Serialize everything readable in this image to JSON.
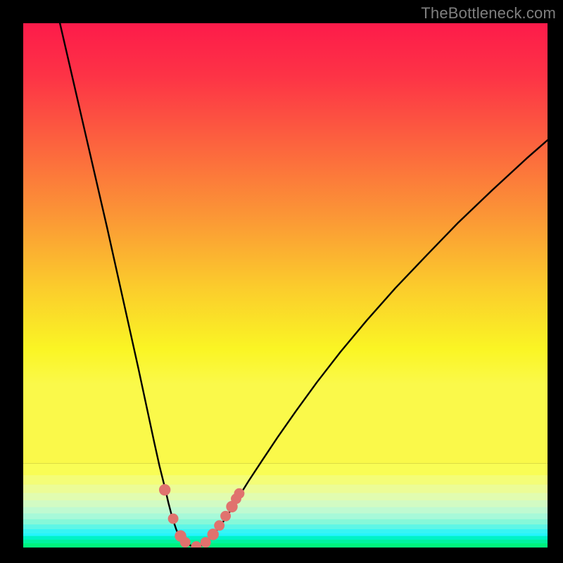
{
  "watermark": "TheBottleneck.com",
  "chart_data": {
    "type": "line",
    "title": "",
    "xlabel": "",
    "ylabel": "",
    "xlim": [
      0,
      100
    ],
    "ylim": [
      0,
      100
    ],
    "grid": false,
    "legend": false,
    "background_gradient": {
      "bands": [
        {
          "color": "#fd1b4a",
          "note": "top"
        },
        {
          "color": "#fc653e",
          "note": "upper-mid"
        },
        {
          "color": "#fbb631",
          "note": "mid"
        },
        {
          "color": "#faf524",
          "note": "lower-mid"
        },
        {
          "color": "#f9fd55",
          "note": "pale-yellow"
        },
        {
          "color": "#e1fcb0",
          "note": "yellow-green"
        },
        {
          "color": "#86f8d8",
          "note": "mint"
        },
        {
          "color": "#24f4fc",
          "note": "cyan"
        },
        {
          "color": "#00f37e",
          "note": "green-base"
        }
      ]
    },
    "series": [
      {
        "name": "bottleneck-curve-left",
        "stroke": "#000000",
        "x": [
          7,
          10,
          13,
          16,
          18,
          20,
          22,
          23.5,
          25,
          26,
          27,
          27.7,
          28.3,
          28.8,
          29.2,
          29.6,
          30.0,
          30.5,
          31.0,
          31.5,
          32.0,
          32.5,
          33.0
        ],
        "y": [
          100,
          87,
          74,
          61,
          52,
          43,
          34,
          27,
          20,
          15.5,
          11.5,
          8.5,
          6.2,
          4.6,
          3.4,
          2.5,
          1.9,
          1.3,
          0.9,
          0.6,
          0.35,
          0.2,
          0.1
        ]
      },
      {
        "name": "bottleneck-curve-right",
        "stroke": "#000000",
        "x": [
          33.0,
          33.5,
          34.0,
          34.6,
          35.3,
          36.1,
          37.1,
          38.2,
          39.5,
          41,
          43,
          45.5,
          48.5,
          52,
          56,
          60.5,
          65.5,
          71,
          77,
          83,
          89.5,
          96,
          100
        ],
        "y": [
          0.1,
          0.22,
          0.45,
          0.8,
          1.4,
          2.3,
          3.5,
          5.0,
          7.0,
          9.5,
          12.7,
          16.5,
          21.0,
          26.0,
          31.5,
          37.3,
          43.3,
          49.5,
          55.8,
          62.0,
          68.2,
          74.2,
          77.7
        ]
      }
    ],
    "markers": [
      {
        "x": 27.0,
        "y": 11.0,
        "r": 1.1,
        "color": "#e0726e",
        "name": "marker-left-upper"
      },
      {
        "x": 28.6,
        "y": 5.5,
        "r": 1.0,
        "color": "#e0726e",
        "name": "marker-left-mid"
      },
      {
        "x": 30.0,
        "y": 2.2,
        "r": 1.1,
        "color": "#e0726e",
        "name": "marker-left-low-a"
      },
      {
        "x": 30.9,
        "y": 1.0,
        "r": 1.0,
        "color": "#e0726e",
        "name": "marker-left-low-b"
      },
      {
        "x": 33.0,
        "y": 0.2,
        "r": 1.0,
        "color": "#e0726e",
        "name": "marker-valley"
      },
      {
        "x": 34.8,
        "y": 1.0,
        "r": 1.0,
        "color": "#e0726e",
        "name": "marker-right-low-a"
      },
      {
        "x": 36.2,
        "y": 2.5,
        "r": 1.1,
        "color": "#e0726e",
        "name": "marker-right-low-b"
      },
      {
        "x": 37.4,
        "y": 4.2,
        "r": 1.0,
        "color": "#e0726e",
        "name": "marker-right-mid-a"
      },
      {
        "x": 38.6,
        "y": 6.0,
        "r": 1.0,
        "color": "#e0726e",
        "name": "marker-right-mid-b"
      },
      {
        "x": 39.8,
        "y": 7.8,
        "r": 1.1,
        "color": "#e0726e",
        "name": "marker-right-upper-a"
      },
      {
        "x": 40.6,
        "y": 9.3,
        "r": 1.0,
        "color": "#e0726e",
        "name": "marker-right-upper-b"
      },
      {
        "x": 41.2,
        "y": 10.3,
        "r": 1.0,
        "color": "#e0726e",
        "name": "marker-right-upper-c"
      }
    ]
  }
}
